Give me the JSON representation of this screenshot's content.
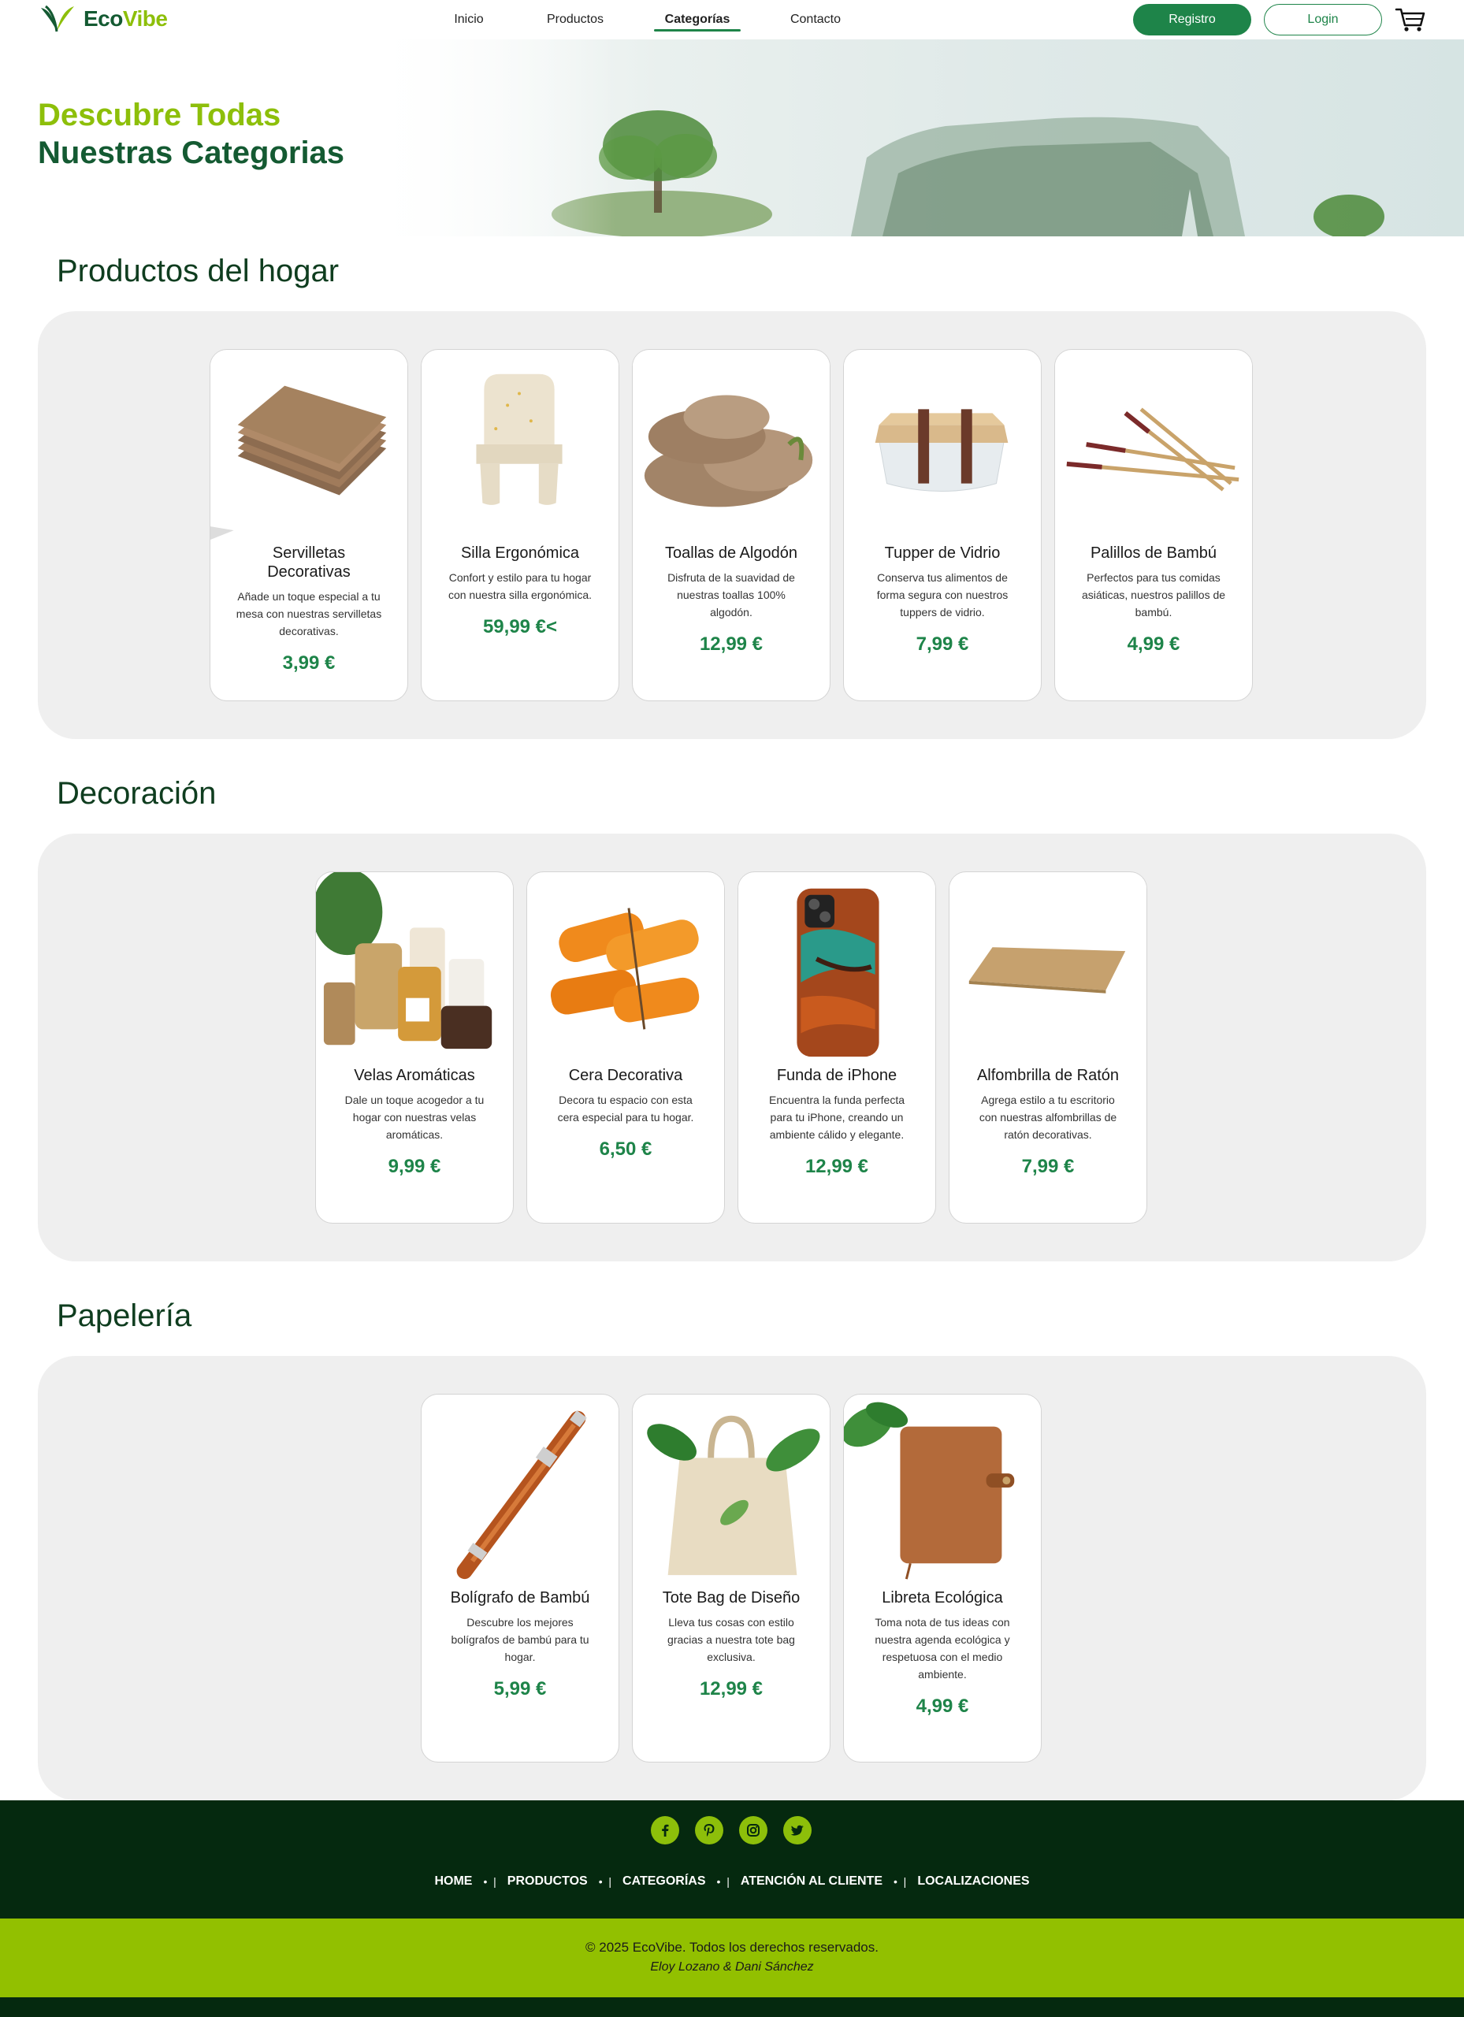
{
  "brand": {
    "name_part1": "Eco",
    "name_part2": "Vibe"
  },
  "nav": {
    "links": [
      {
        "label": "Inicio"
      },
      {
        "label": "Productos"
      },
      {
        "label": "Categorías"
      },
      {
        "label": "Contacto"
      }
    ],
    "registro_label": "Registro",
    "login_label": "Login"
  },
  "hero": {
    "line1": "Descubre Todas",
    "line2": "Nuestras Categorias"
  },
  "sections": [
    {
      "title": "Productos del hogar",
      "cards": [
        {
          "name": "Servilletas Decorativas",
          "desc": "Añade un toque especial a tu mesa con nuestras servilletas decorativas.",
          "price": "3,99 €",
          "icon": "napkins-image"
        },
        {
          "name": "Silla Ergonómica",
          "desc": "Confort y estilo para tu hogar con nuestra silla ergonómica.",
          "price": "59,99 €<",
          "icon": "chair-image"
        },
        {
          "name": "Toallas de Algodón",
          "desc": "Disfruta de la suavidad de nuestras toallas 100% algodón.",
          "price": "12,99 €",
          "icon": "towels-image"
        },
        {
          "name": "Tupper de Vidrio",
          "desc": "Conserva tus alimentos de forma segura con nuestros tuppers de vidrio.",
          "price": "7,99 €",
          "icon": "glass-container-image"
        },
        {
          "name": "Palillos de Bambú",
          "desc": "Perfectos para tus comidas asiáticas, nuestros palillos de bambú.",
          "price": "4,99 €",
          "icon": "chopsticks-image"
        }
      ]
    },
    {
      "title": "Decoración",
      "cards": [
        {
          "name": "Velas Aromáticas",
          "desc": "Dale un toque acogedor a tu hogar con nuestras velas aromáticas.",
          "price": "9,99 €",
          "icon": "candles-image"
        },
        {
          "name": "Cera Decorativa",
          "desc": "Decora tu espacio con esta cera especial para tu hogar.",
          "price": "6,50 €",
          "icon": "wax-image"
        },
        {
          "name": "Funda de iPhone",
          "desc": "Encuentra la funda perfecta para tu iPhone, creando un ambiente cálido y elegante.",
          "price": "12,99 €",
          "icon": "phone-case-image"
        },
        {
          "name": "Alfombrilla de Ratón",
          "desc": "Agrega estilo a tu escritorio con nuestras alfombrillas de ratón decorativas.",
          "price": "7,99 €",
          "icon": "mousepad-image"
        }
      ]
    },
    {
      "title": "Papelería",
      "cards": [
        {
          "name": "Bolígrafo de Bambú",
          "desc": "Descubre los mejores bolígrafos de bambú para tu hogar.",
          "price": "5,99 €",
          "icon": "pen-image"
        },
        {
          "name": "Tote Bag de Diseño",
          "desc": "Lleva tus cosas con estilo gracias a nuestra tote bag exclusiva.",
          "price": "12,99 €",
          "icon": "tote-bag-image"
        },
        {
          "name": "Libreta Ecológica",
          "desc": "Toma nota de tus ideas con nuestra agenda ecológica y respetuosa con el medio ambiente.",
          "price": "4,99 €",
          "icon": "notebook-image"
        }
      ]
    }
  ],
  "footer": {
    "socials": [
      {
        "icon": "facebook-icon"
      },
      {
        "icon": "pinterest-icon"
      },
      {
        "icon": "instagram-icon"
      },
      {
        "icon": "twitter-icon"
      }
    ],
    "links": [
      {
        "label": "HOME"
      },
      {
        "label": "PRODUCTOS"
      },
      {
        "label": "CATEGORÍAS"
      },
      {
        "label": "ATENCIÓN AL CLIENTE"
      },
      {
        "label": "LOCALIZACIONES"
      }
    ],
    "copyright": "© 2025 EcoVibe. Todos los derechos reservados.",
    "authors": "Eloy Lozano & Dani Sánchez"
  },
  "colors": {
    "brand_dark_green": "#145a32",
    "brand_lime": "#8dbf0a",
    "price_green": "#1e8449",
    "footer_dark": "#05290f",
    "footer_lime": "#92c000"
  }
}
